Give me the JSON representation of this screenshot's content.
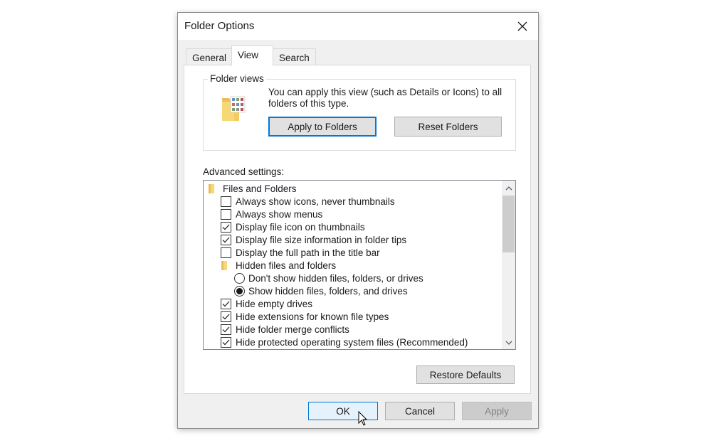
{
  "window": {
    "title": "Folder Options"
  },
  "tabs": [
    {
      "label": "General",
      "active": false
    },
    {
      "label": "View",
      "active": true
    },
    {
      "label": "Search",
      "active": false
    }
  ],
  "folder_views": {
    "label": "Folder views",
    "description": "You can apply this view (such as Details or Icons) to all folders of this type.",
    "apply_button": "Apply to Folders",
    "reset_button": "Reset Folders"
  },
  "advanced": {
    "label": "Advanced settings:",
    "items": [
      {
        "type": "folder",
        "label": "Files and Folders",
        "level": 0
      },
      {
        "type": "checkbox",
        "label": "Always show icons, never thumbnails",
        "checked": false,
        "level": 1
      },
      {
        "type": "checkbox",
        "label": "Always show menus",
        "checked": false,
        "level": 1
      },
      {
        "type": "checkbox",
        "label": "Display file icon on thumbnails",
        "checked": true,
        "level": 1
      },
      {
        "type": "checkbox",
        "label": "Display file size information in folder tips",
        "checked": true,
        "level": 1
      },
      {
        "type": "checkbox",
        "label": "Display the full path in the title bar",
        "checked": false,
        "level": 1
      },
      {
        "type": "folder",
        "label": "Hidden files and folders",
        "level": 1
      },
      {
        "type": "radio",
        "label": "Don't show hidden files, folders, or drives",
        "checked": false,
        "level": 2
      },
      {
        "type": "radio",
        "label": "Show hidden files, folders, and drives",
        "checked": true,
        "level": 2
      },
      {
        "type": "checkbox",
        "label": "Hide empty drives",
        "checked": true,
        "level": 1
      },
      {
        "type": "checkbox",
        "label": "Hide extensions for known file types",
        "checked": true,
        "level": 1
      },
      {
        "type": "checkbox",
        "label": "Hide folder merge conflicts",
        "checked": true,
        "level": 1
      },
      {
        "type": "checkbox",
        "label": "Hide protected operating system files (Recommended)",
        "checked": true,
        "level": 1
      }
    ],
    "restore_button": "Restore Defaults"
  },
  "footer": {
    "ok": "OK",
    "cancel": "Cancel",
    "apply": "Apply"
  },
  "colors": {
    "accent": "#0078d7",
    "folder_yellow": "#f8d775"
  }
}
